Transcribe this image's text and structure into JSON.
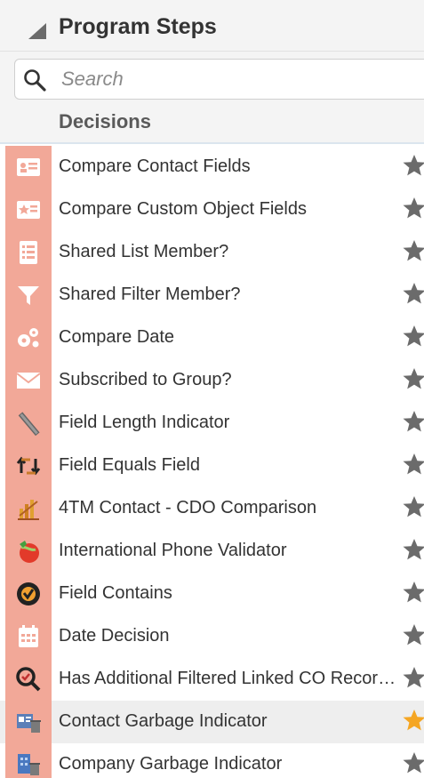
{
  "panel": {
    "title": "Program Steps"
  },
  "search": {
    "placeholder": "Search",
    "value": ""
  },
  "section": {
    "title": "Decisions"
  },
  "colors": {
    "icon_bg": "#f2a898",
    "star_default": "#6b6b6b",
    "star_active": "#f5a623",
    "selected_row": "#eeeeee"
  },
  "steps": [
    {
      "label": "Compare Contact Fields",
      "icon": "contact-card-icon",
      "favorite": false
    },
    {
      "label": "Compare Custom Object Fields",
      "icon": "custom-object-star-icon",
      "favorite": false
    },
    {
      "label": "Shared List Member?",
      "icon": "list-icon",
      "favorite": false
    },
    {
      "label": "Shared Filter Member?",
      "icon": "filter-icon",
      "favorite": false
    },
    {
      "label": "Compare Date",
      "icon": "gears-icon",
      "favorite": false
    },
    {
      "label": "Subscribed to Group?",
      "icon": "envelope-icon",
      "favorite": false
    },
    {
      "label": "Field Length Indicator",
      "icon": "ruler-icon",
      "favorite": false
    },
    {
      "label": "Field Equals Field",
      "icon": "swap-arrows-icon",
      "favorite": false
    },
    {
      "label": "4TM Contact - CDO Comparison",
      "icon": "chart-pencil-icon",
      "favorite": false
    },
    {
      "label": "International Phone Validator",
      "icon": "phone-globe-icon",
      "favorite": false
    },
    {
      "label": "Field Contains",
      "icon": "circle-check-icon",
      "favorite": false
    },
    {
      "label": "Date Decision",
      "icon": "calendar-icon",
      "favorite": false
    },
    {
      "label": "Has Additional Filtered Linked CO Records",
      "icon": "magnifier-icon",
      "favorite": false
    },
    {
      "label": "Contact Garbage Indicator",
      "icon": "contact-trash-icon",
      "favorite": true,
      "selected": true
    },
    {
      "label": "Company Garbage Indicator",
      "icon": "company-trash-icon",
      "favorite": false
    }
  ]
}
